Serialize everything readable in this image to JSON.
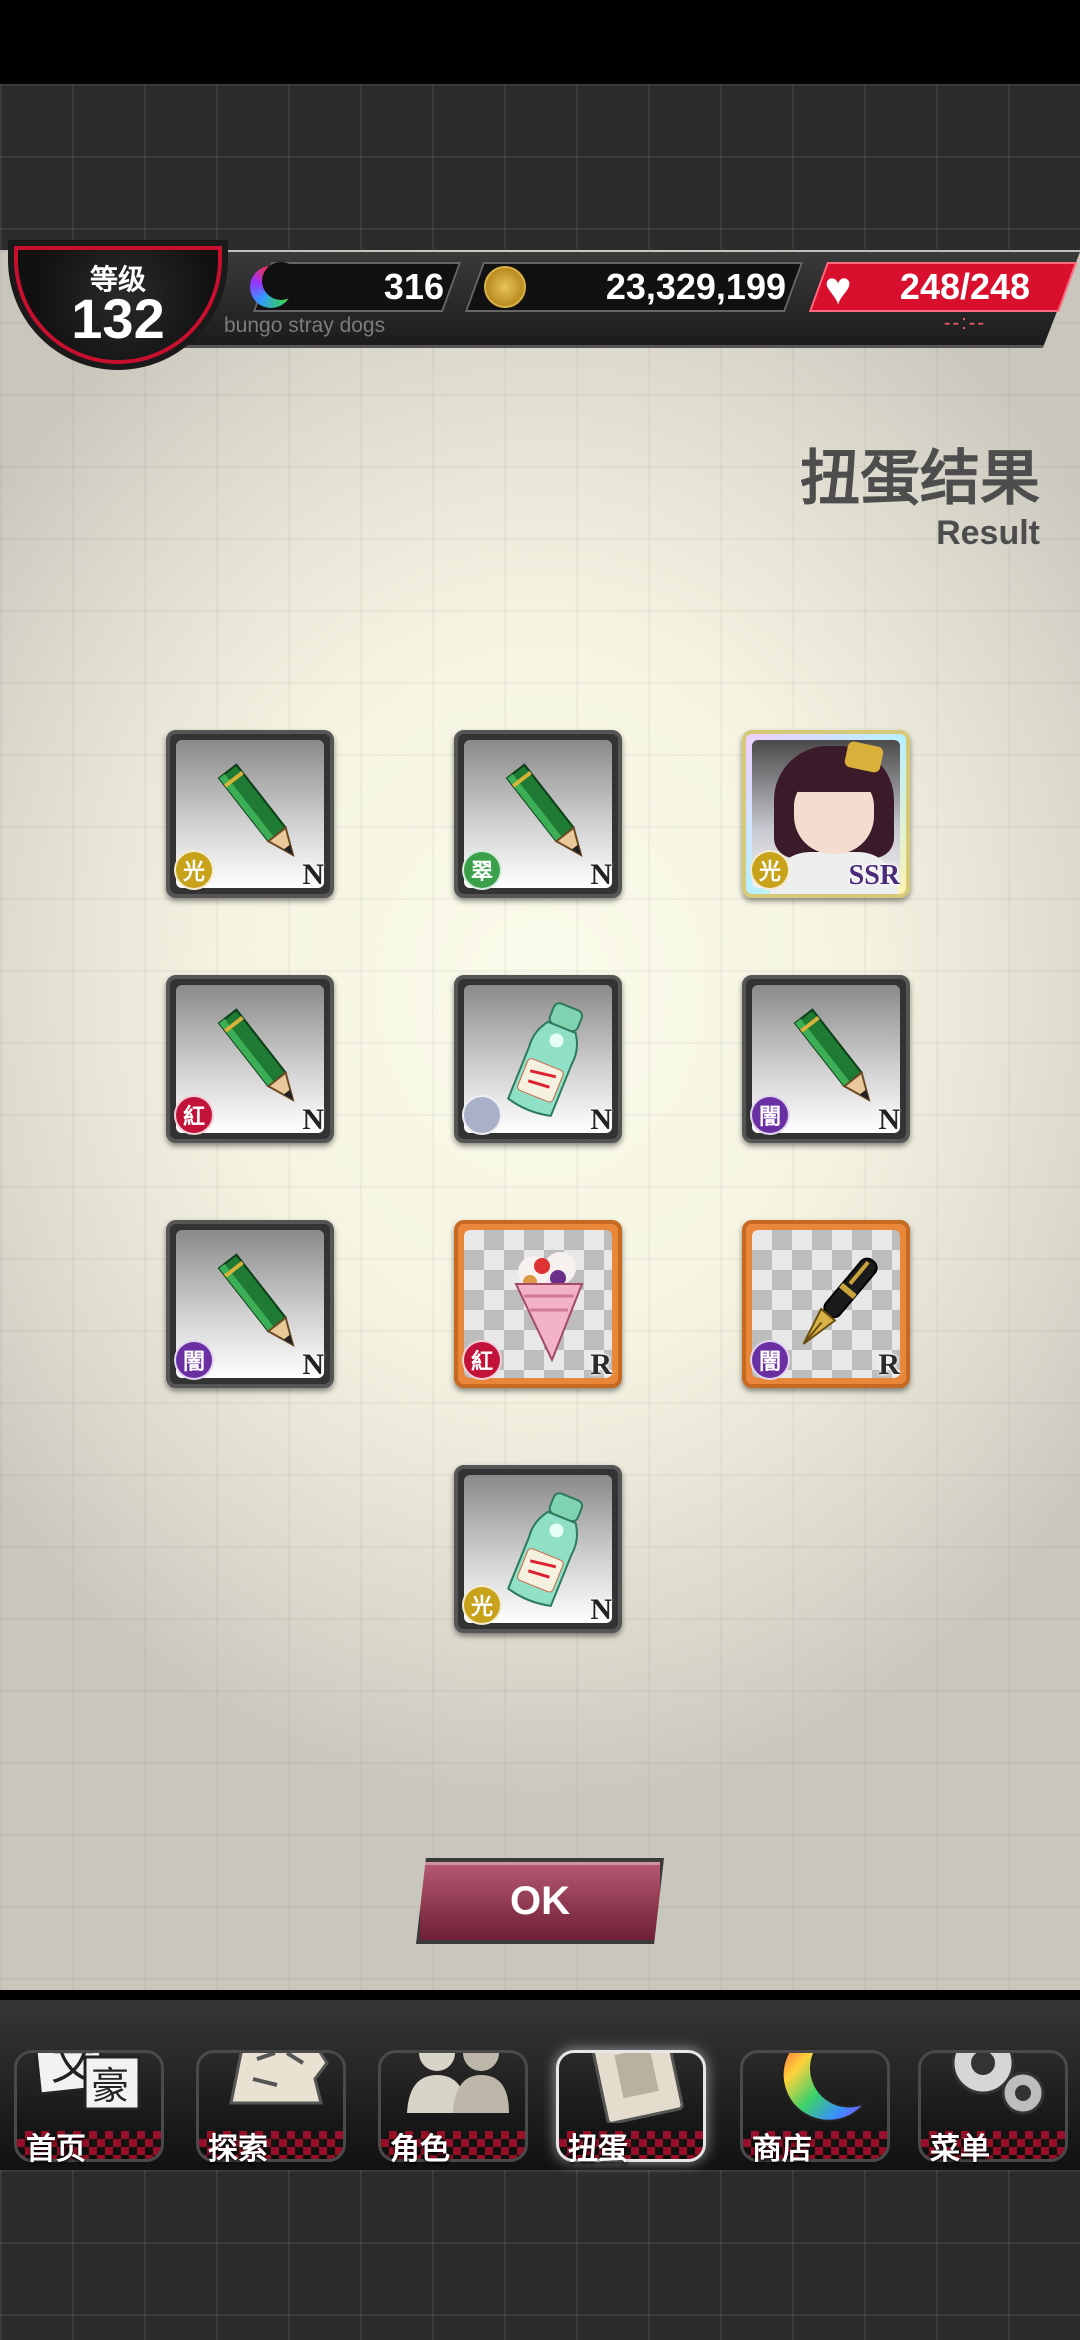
{
  "hud": {
    "level_label": "等级",
    "level_value": "132",
    "moon_count": "316",
    "coins": "23,329,199",
    "hp": "248/248",
    "hp_timer": "--:--",
    "game_name": "bungo stray dogs"
  },
  "page": {
    "title": "扭蛋结果",
    "subtitle": "Result"
  },
  "results": [
    {
      "item": "pencil-icon",
      "attribute": "光",
      "attribute_color": "#c7a21a",
      "rarity": "N"
    },
    {
      "item": "pencil-icon",
      "attribute": "翠",
      "attribute_color": "#3aa04a",
      "rarity": "N"
    },
    {
      "item": "character-portrait",
      "attribute": "光",
      "attribute_color": "#c7a21a",
      "rarity": "SSR"
    },
    {
      "item": "pencil-icon",
      "attribute": "紅",
      "attribute_color": "#c2123a",
      "rarity": "N"
    },
    {
      "item": "ramune-bottle-icon",
      "attribute": "",
      "attribute_color": "#aab0c8",
      "rarity": "N"
    },
    {
      "item": "pencil-icon",
      "attribute": "闇",
      "attribute_color": "#6a2fa3",
      "rarity": "N"
    },
    {
      "item": "pencil-icon",
      "attribute": "闇",
      "attribute_color": "#6a2fa3",
      "rarity": "N"
    },
    {
      "item": "crepe-icon",
      "attribute": "紅",
      "attribute_color": "#c2123a",
      "rarity": "R"
    },
    {
      "item": "fountain-pen-icon",
      "attribute": "闇",
      "attribute_color": "#6a2fa3",
      "rarity": "R"
    },
    {
      "item": "ramune-bottle-icon",
      "attribute": "光",
      "attribute_color": "#c7a21a",
      "rarity": "N"
    }
  ],
  "ok_label": "OK",
  "nav": [
    {
      "label": "首页",
      "icon": "home-icon"
    },
    {
      "label": "探索",
      "icon": "tiger-icon"
    },
    {
      "label": "角色",
      "icon": "characters-icon"
    },
    {
      "label": "扭蛋",
      "icon": "gacha-book-icon"
    },
    {
      "label": "商店",
      "icon": "shop-moon-icon"
    },
    {
      "label": "菜单",
      "icon": "gear-icon"
    }
  ]
}
